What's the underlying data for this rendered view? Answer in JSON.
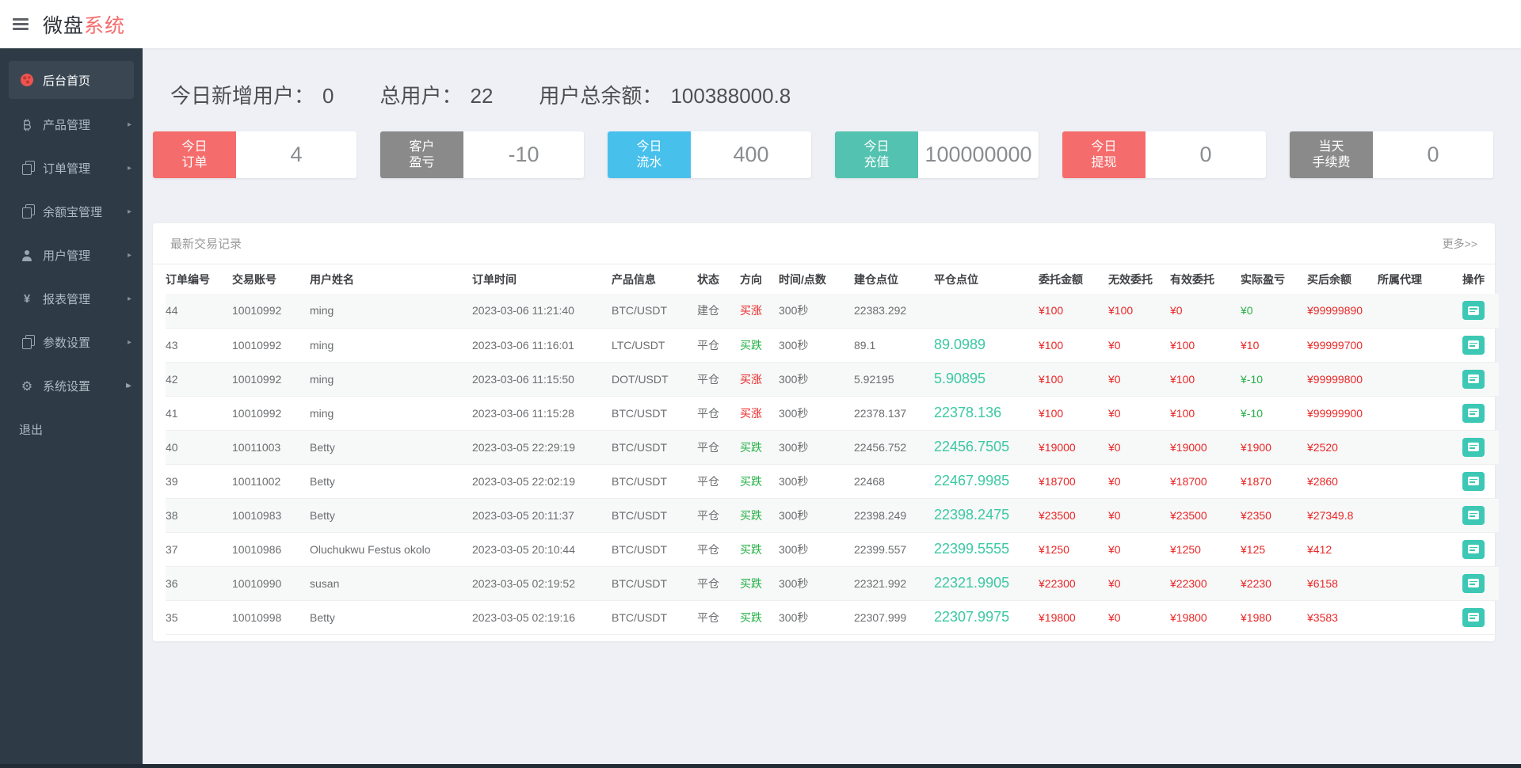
{
  "header": {
    "brand_black": "微盘",
    "brand_red": "系统"
  },
  "sidebar": {
    "items": [
      {
        "label": "后台首页",
        "icon": "dashboard-icon",
        "active": true,
        "has_arrow": false
      },
      {
        "label": "产品管理",
        "icon": "bitcoin-icon",
        "active": false,
        "has_arrow": true
      },
      {
        "label": "订单管理",
        "icon": "orders-copy-icon",
        "active": false,
        "has_arrow": true
      },
      {
        "label": "余额宝管理",
        "icon": "balance-copy-icon",
        "active": false,
        "has_arrow": true
      },
      {
        "label": "用户管理",
        "icon": "user-icon",
        "active": false,
        "has_arrow": true
      },
      {
        "label": "报表管理",
        "icon": "yen-icon",
        "active": false,
        "has_arrow": true
      },
      {
        "label": "参数设置",
        "icon": "params-copy-icon",
        "active": false,
        "has_arrow": true
      },
      {
        "label": "系统设置",
        "icon": "gear-icon",
        "active": false,
        "has_arrow": true
      },
      {
        "label": "退出",
        "icon": "none",
        "active": false,
        "has_arrow": false
      }
    ]
  },
  "stats": [
    {
      "label": "今日新增用户：",
      "value": "0"
    },
    {
      "label": "总用户：",
      "value": "22"
    },
    {
      "label": "用户总余额：",
      "value": "100388000.8"
    }
  ],
  "cards": [
    {
      "label": "今日\n订单",
      "value": "4",
      "color": "#f56c6c"
    },
    {
      "label": "客户\n盈亏",
      "value": "-10",
      "color": "#8a8a8a"
    },
    {
      "label": "今日\n流水",
      "value": "400",
      "color": "#47c0ec"
    },
    {
      "label": "今日\n充值",
      "value": "100000000",
      "color": "#54c2b0"
    },
    {
      "label": "今日\n提现",
      "value": "0",
      "color": "#f56c6c"
    },
    {
      "label": "当天\n手续费",
      "value": "0",
      "color": "#8a8a8a"
    }
  ],
  "panel": {
    "title": "最新交易记录",
    "more": "更多>>"
  },
  "table": {
    "columns": [
      "订单编号",
      "交易账号",
      "用户姓名",
      "订单时间",
      "产品信息",
      "状态",
      "方向",
      "时间/点数",
      "建仓点位",
      "平仓点位",
      "委托金额",
      "无效委托",
      "有效委托",
      "实际盈亏",
      "买后余额",
      "所属代理",
      "操作"
    ],
    "rows": [
      {
        "id": "44",
        "account": "10010992",
        "name": "ming",
        "time": "2023-03-06 11:21:40",
        "product": "BTC/USDT",
        "status": "建仓",
        "direction": "买涨",
        "direction_color": "red",
        "duration": "300秒",
        "open": "22383.292",
        "close": "",
        "entrust": "¥100",
        "invalid": "¥100",
        "valid": "¥0",
        "pl": "¥0",
        "pl_color": "green",
        "balance": "¥99999890",
        "agent": ""
      },
      {
        "id": "43",
        "account": "10010992",
        "name": "ming",
        "time": "2023-03-06 11:16:01",
        "product": "LTC/USDT",
        "status": "平仓",
        "direction": "买跌",
        "direction_color": "green",
        "duration": "300秒",
        "open": "89.1",
        "close": "89.0989",
        "entrust": "¥100",
        "invalid": "¥0",
        "valid": "¥100",
        "pl": "¥10",
        "pl_color": "red",
        "balance": "¥99999700",
        "agent": ""
      },
      {
        "id": "42",
        "account": "10010992",
        "name": "ming",
        "time": "2023-03-06 11:15:50",
        "product": "DOT/USDT",
        "status": "平仓",
        "direction": "买涨",
        "direction_color": "red",
        "duration": "300秒",
        "open": "5.92195",
        "close": "5.90895",
        "entrust": "¥100",
        "invalid": "¥0",
        "valid": "¥100",
        "pl": "¥-10",
        "pl_color": "green",
        "balance": "¥99999800",
        "agent": ""
      },
      {
        "id": "41",
        "account": "10010992",
        "name": "ming",
        "time": "2023-03-06 11:15:28",
        "product": "BTC/USDT",
        "status": "平仓",
        "direction": "买涨",
        "direction_color": "red",
        "duration": "300秒",
        "open": "22378.137",
        "close": "22378.136",
        "entrust": "¥100",
        "invalid": "¥0",
        "valid": "¥100",
        "pl": "¥-10",
        "pl_color": "green",
        "balance": "¥99999900",
        "agent": ""
      },
      {
        "id": "40",
        "account": "10011003",
        "name": "Betty",
        "time": "2023-03-05 22:29:19",
        "product": "BTC/USDT",
        "status": "平仓",
        "direction": "买跌",
        "direction_color": "green",
        "duration": "300秒",
        "open": "22456.752",
        "close": "22456.7505",
        "entrust": "¥19000",
        "invalid": "¥0",
        "valid": "¥19000",
        "pl": "¥1900",
        "pl_color": "red",
        "balance": "¥2520",
        "agent": ""
      },
      {
        "id": "39",
        "account": "10011002",
        "name": "Betty",
        "time": "2023-03-05 22:02:19",
        "product": "BTC/USDT",
        "status": "平仓",
        "direction": "买跌",
        "direction_color": "green",
        "duration": "300秒",
        "open": "22468",
        "close": "22467.9985",
        "entrust": "¥18700",
        "invalid": "¥0",
        "valid": "¥18700",
        "pl": "¥1870",
        "pl_color": "red",
        "balance": "¥2860",
        "agent": ""
      },
      {
        "id": "38",
        "account": "10010983",
        "name": "Betty",
        "time": "2023-03-05 20:11:37",
        "product": "BTC/USDT",
        "status": "平仓",
        "direction": "买跌",
        "direction_color": "green",
        "duration": "300秒",
        "open": "22398.249",
        "close": "22398.2475",
        "entrust": "¥23500",
        "invalid": "¥0",
        "valid": "¥23500",
        "pl": "¥2350",
        "pl_color": "red",
        "balance": "¥27349.8",
        "agent": ""
      },
      {
        "id": "37",
        "account": "10010986",
        "name": "Oluchukwu Festus okolo",
        "time": "2023-03-05 20:10:44",
        "product": "BTC/USDT",
        "status": "平仓",
        "direction": "买跌",
        "direction_color": "green",
        "duration": "300秒",
        "open": "22399.557",
        "close": "22399.5555",
        "entrust": "¥1250",
        "invalid": "¥0",
        "valid": "¥1250",
        "pl": "¥125",
        "pl_color": "red",
        "balance": "¥412",
        "agent": ""
      },
      {
        "id": "36",
        "account": "10010990",
        "name": "susan",
        "time": "2023-03-05 02:19:52",
        "product": "BTC/USDT",
        "status": "平仓",
        "direction": "买跌",
        "direction_color": "green",
        "duration": "300秒",
        "open": "22321.992",
        "close": "22321.9905",
        "entrust": "¥22300",
        "invalid": "¥0",
        "valid": "¥22300",
        "pl": "¥2230",
        "pl_color": "red",
        "balance": "¥6158",
        "agent": ""
      },
      {
        "id": "35",
        "account": "10010998",
        "name": "Betty",
        "time": "2023-03-05 02:19:16",
        "product": "BTC/USDT",
        "status": "平仓",
        "direction": "买跌",
        "direction_color": "green",
        "duration": "300秒",
        "open": "22307.999",
        "close": "22307.9975",
        "entrust": "¥19800",
        "invalid": "¥0",
        "valid": "¥19800",
        "pl": "¥1980",
        "pl_color": "red",
        "balance": "¥3583",
        "agent": ""
      }
    ]
  },
  "colors": {
    "accent_red": "#f56c6c",
    "table_red": "#ea2727",
    "table_green": "#27b148",
    "close_green": "#3bc9a2",
    "card_blue": "#47c0ec",
    "card_teal": "#54c2b0",
    "card_gray": "#8a8a8a",
    "op_button_teal": "#3cc8b4",
    "sidebar_bg": "#2e3a45"
  }
}
